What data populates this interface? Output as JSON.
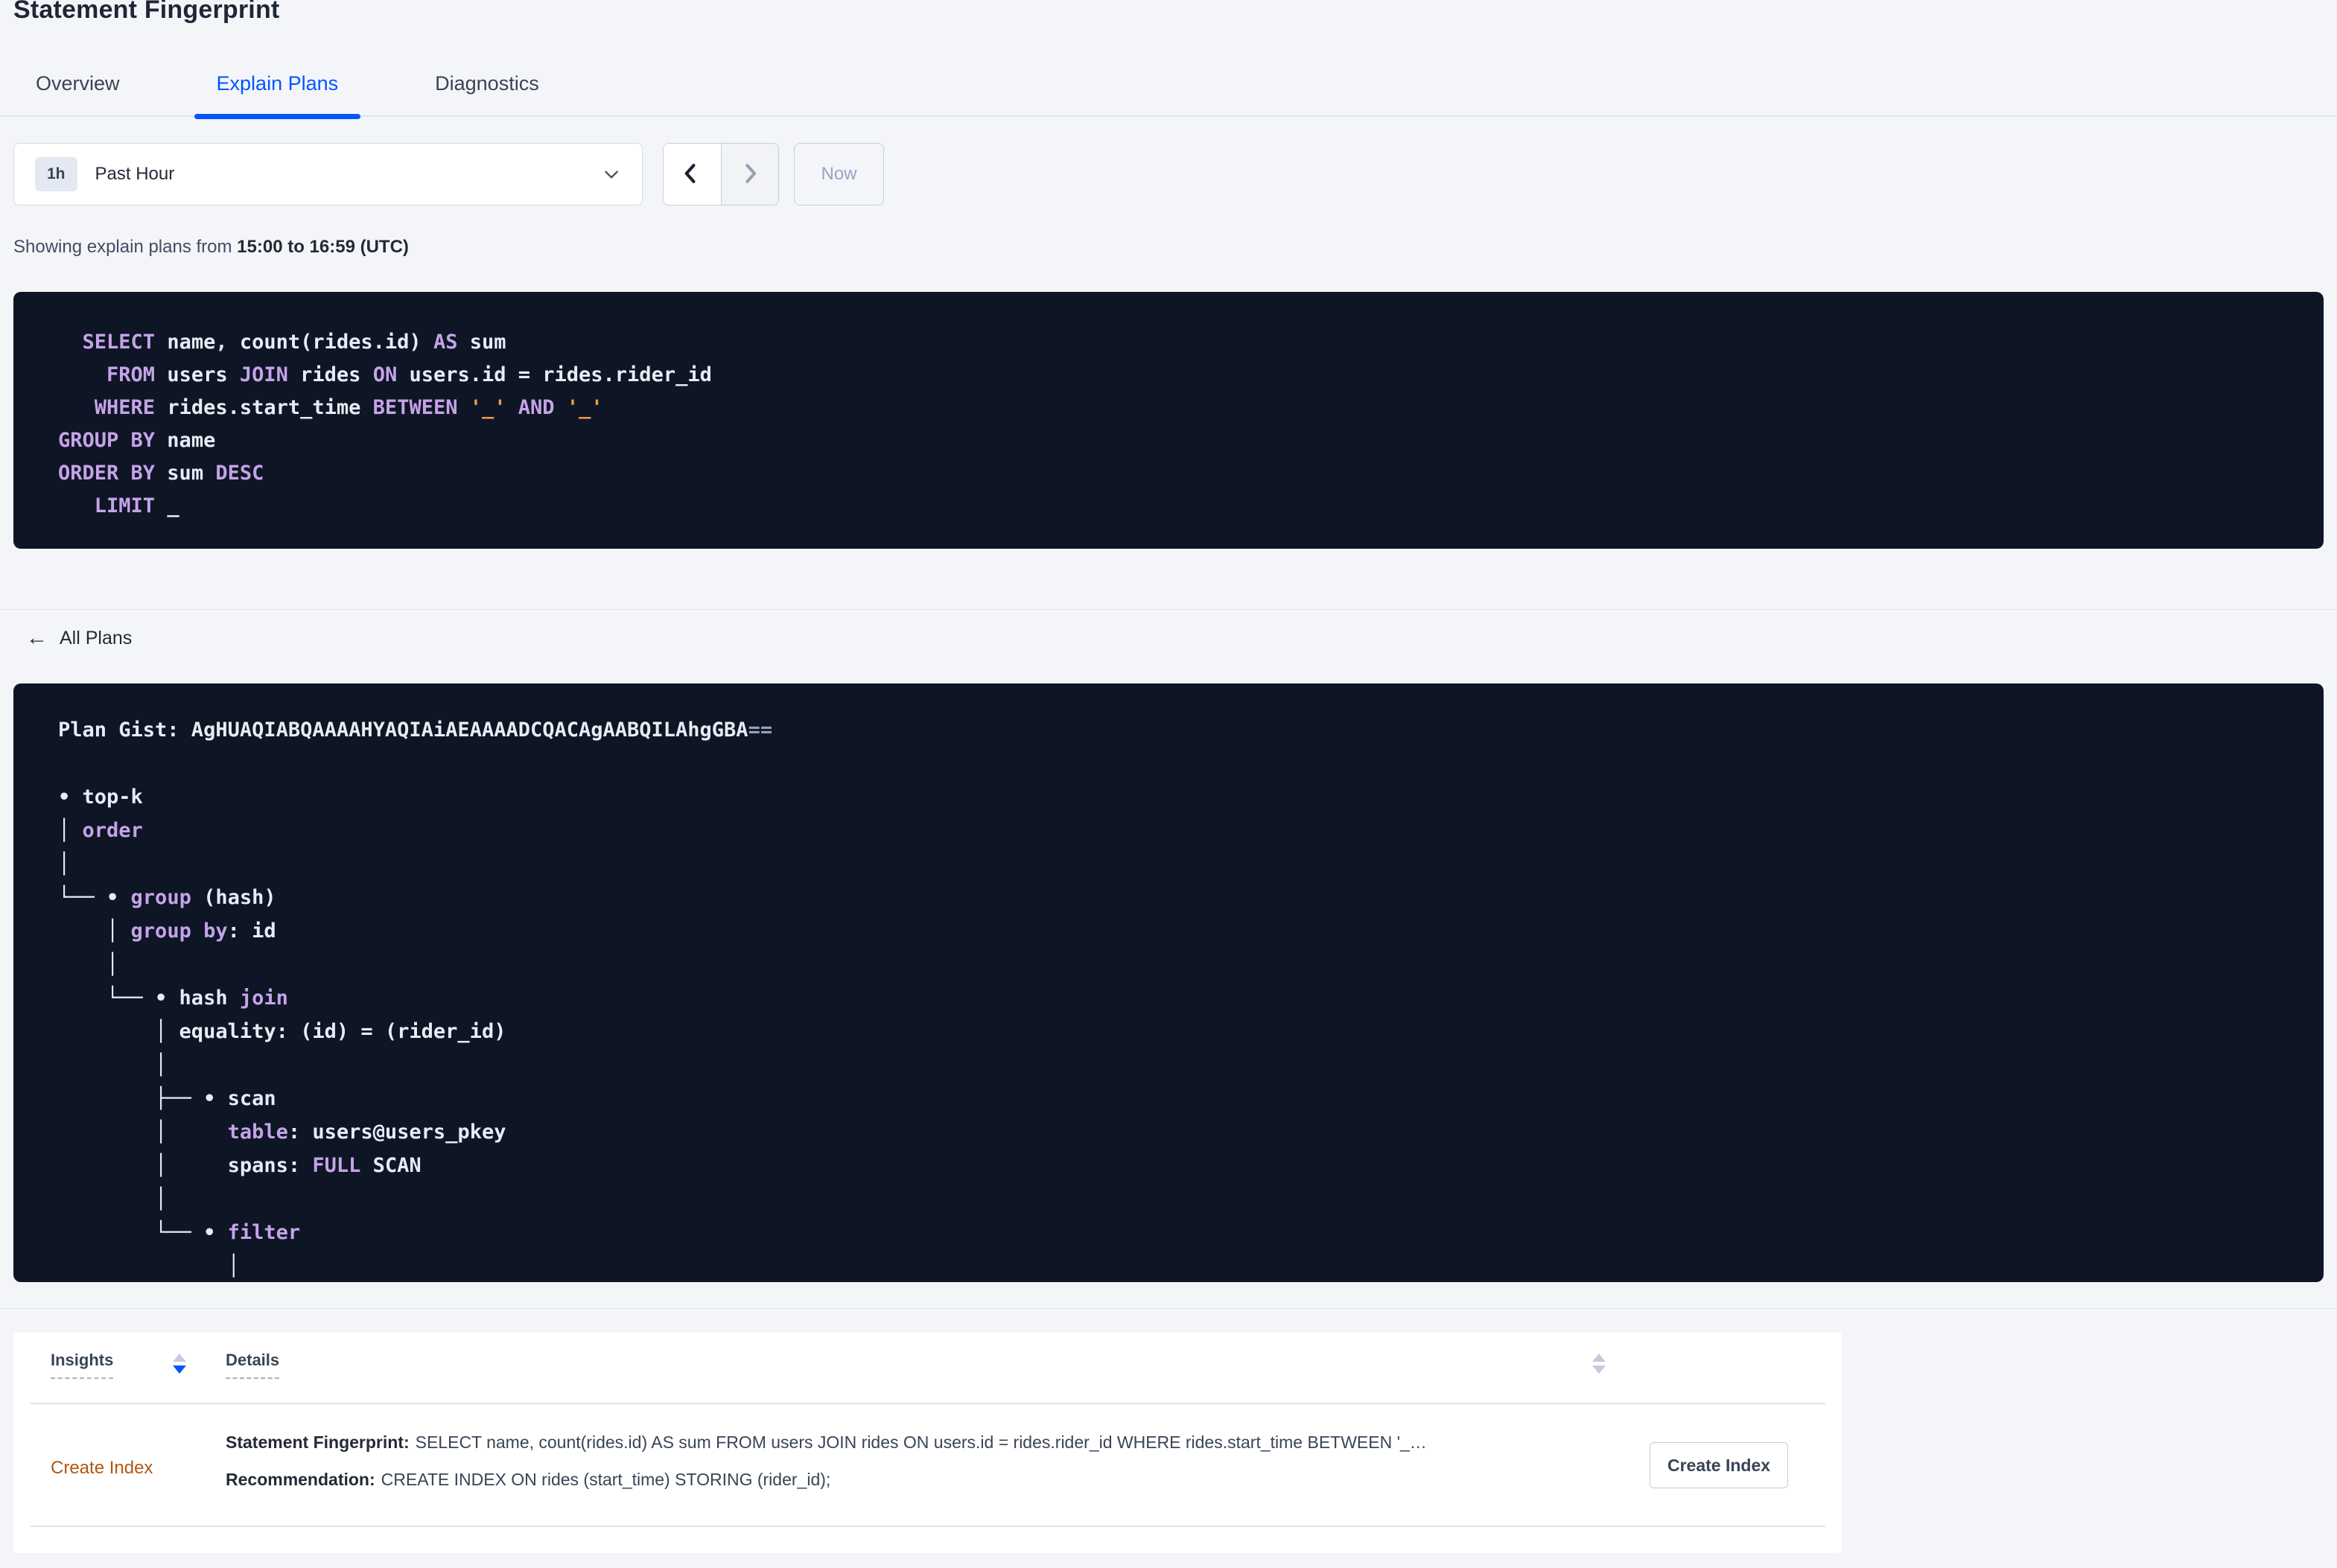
{
  "page": {
    "title": "Statement Fingerprint"
  },
  "tabs": [
    {
      "label": "Overview",
      "active": false
    },
    {
      "label": "Explain Plans",
      "active": true
    },
    {
      "label": "Diagnostics",
      "active": false
    }
  ],
  "time_picker": {
    "badge": "1h",
    "label": "Past Hour",
    "now_label": "Now"
  },
  "showing": {
    "prefix": "Showing explain plans from ",
    "range": "15:00 to 16:59 (UTC)"
  },
  "sql": {
    "lines": [
      [
        {
          "t": "pl",
          "v": "  "
        },
        {
          "t": "kw",
          "v": "SELECT"
        },
        {
          "t": "pl",
          "v": " name, count(rides.id) "
        },
        {
          "t": "kw",
          "v": "AS"
        },
        {
          "t": "pl",
          "v": " sum"
        }
      ],
      [
        {
          "t": "pl",
          "v": "    "
        },
        {
          "t": "kw",
          "v": "FROM"
        },
        {
          "t": "pl",
          "v": " users "
        },
        {
          "t": "kw",
          "v": "JOIN"
        },
        {
          "t": "pl",
          "v": " rides "
        },
        {
          "t": "kw",
          "v": "ON"
        },
        {
          "t": "pl",
          "v": " users.id = rides.rider_id"
        }
      ],
      [
        {
          "t": "pl",
          "v": "   "
        },
        {
          "t": "kw",
          "v": "WHERE"
        },
        {
          "t": "pl",
          "v": " rides.start_time "
        },
        {
          "t": "kw",
          "v": "BETWEEN"
        },
        {
          "t": "pl",
          "v": " "
        },
        {
          "t": "str",
          "v": "'_'"
        },
        {
          "t": "pl",
          "v": " "
        },
        {
          "t": "kw",
          "v": "AND"
        },
        {
          "t": "pl",
          "v": " "
        },
        {
          "t": "str",
          "v": "'_'"
        }
      ],
      [
        {
          "t": "kw",
          "v": "GROUP BY"
        },
        {
          "t": "pl",
          "v": " name"
        }
      ],
      [
        {
          "t": "kw",
          "v": "ORDER BY"
        },
        {
          "t": "pl",
          "v": " sum "
        },
        {
          "t": "kw",
          "v": "DESC"
        }
      ],
      [
        {
          "t": "pl",
          "v": "   "
        },
        {
          "t": "kw",
          "v": "LIMIT"
        },
        {
          "t": "pl",
          "v": " _"
        }
      ]
    ]
  },
  "all_plans_label": "All Plans",
  "plan": {
    "gist": "AgHUAQIABQAAAAHYAQIAiAEAAAADCQACAgAABQILAhgGBA==",
    "lines": [
      [
        {
          "t": "pl",
          "v": "Plan Gist: AgHUAQIABQAAAAHYAQIAiAEAAAADCQACAgAABQILAhgGBA"
        },
        {
          "t": "mut",
          "v": "=="
        }
      ],
      [],
      [
        {
          "t": "pl",
          "v": "• top-k"
        }
      ],
      [
        {
          "t": "pl",
          "v": "│ "
        },
        {
          "t": "kw",
          "v": "order"
        }
      ],
      [
        {
          "t": "pl",
          "v": "│"
        }
      ],
      [
        {
          "t": "pl",
          "v": "└── • "
        },
        {
          "t": "kw",
          "v": "group"
        },
        {
          "t": "pl",
          "v": " (hash)"
        }
      ],
      [
        {
          "t": "pl",
          "v": "    │ "
        },
        {
          "t": "kw",
          "v": "group by"
        },
        {
          "t": "pl",
          "v": ": id"
        }
      ],
      [
        {
          "t": "pl",
          "v": "    │"
        }
      ],
      [
        {
          "t": "pl",
          "v": "    └── • hash "
        },
        {
          "t": "kw",
          "v": "join"
        }
      ],
      [
        {
          "t": "pl",
          "v": "        │ equality: (id) = (rider_id)"
        }
      ],
      [
        {
          "t": "pl",
          "v": "        │"
        }
      ],
      [
        {
          "t": "pl",
          "v": "        ├── • scan"
        }
      ],
      [
        {
          "t": "pl",
          "v": "        │     "
        },
        {
          "t": "kw",
          "v": "table"
        },
        {
          "t": "pl",
          "v": ": users@users_pkey"
        }
      ],
      [
        {
          "t": "pl",
          "v": "        │     spans: "
        },
        {
          "t": "kw",
          "v": "FULL"
        },
        {
          "t": "pl",
          "v": " SCAN"
        }
      ],
      [
        {
          "t": "pl",
          "v": "        │"
        }
      ],
      [
        {
          "t": "pl",
          "v": "        └── • "
        },
        {
          "t": "kw",
          "v": "filter"
        }
      ],
      [
        {
          "t": "pl",
          "v": "              │"
        }
      ]
    ]
  },
  "insights_table": {
    "columns": [
      "Insights",
      "Details"
    ],
    "rows": [
      {
        "insight": "Create Index",
        "details": [
          {
            "label": "Statement Fingerprint:",
            "text": "SELECT name, count(rides.id) AS sum FROM users JOIN rides ON users.id = rides.rider_id WHERE rides.start_time BETWEEN '_…"
          },
          {
            "label": "Recommendation:",
            "text": "CREATE INDEX ON rides (start_time) STORING (rider_id);"
          }
        ],
        "action": "Create Index"
      }
    ]
  },
  "icons": {
    "back_arrow": "←"
  },
  "colors": {
    "accent": "#0055ff",
    "insight_link": "#b35711",
    "sql_keyword": "#c5a3e8",
    "sql_string": "#f2994a",
    "code_bg": "#0e1525",
    "code_text": "#e7ecf4",
    "code_muted": "#93a1b8"
  }
}
